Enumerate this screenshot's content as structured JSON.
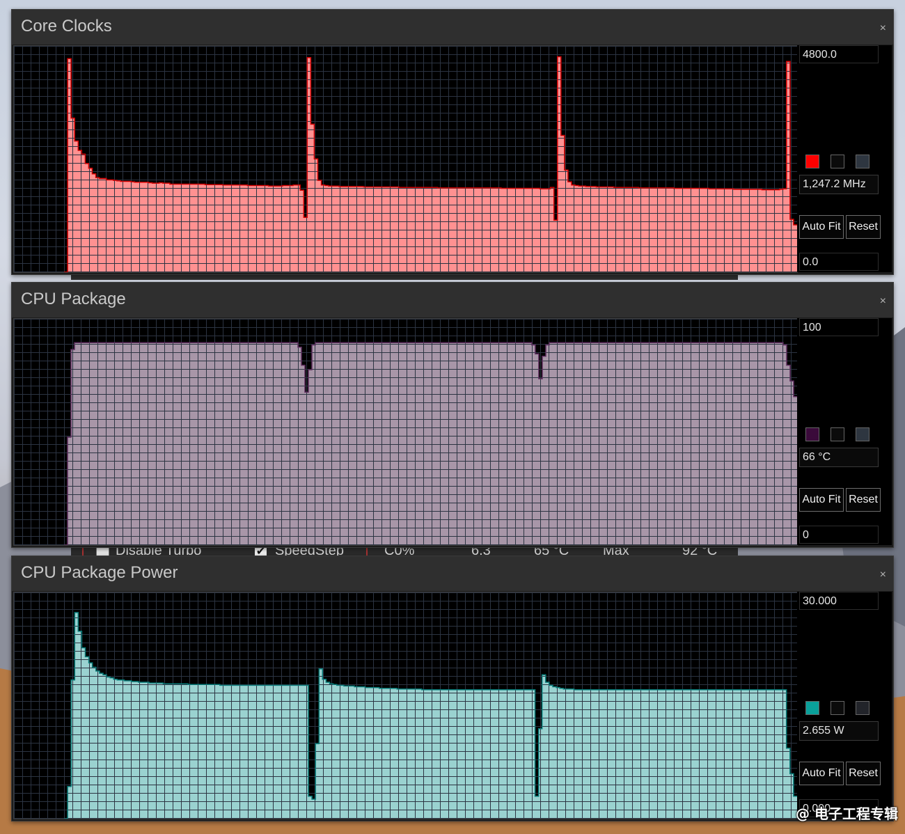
{
  "panels": [
    {
      "id": "core-clocks",
      "title": "Core Clocks",
      "close": "×",
      "max_label": "4800.0",
      "min_label": "0.0",
      "current": "1,247.2 MHz",
      "swatches": [
        "#ff0000",
        "#0b0b0b",
        "#2e3640"
      ],
      "buttons": [
        "Auto Fit",
        "Reset"
      ],
      "fill_color": "#ff9191",
      "edge_color": "#d10000",
      "ymax": 4800,
      "series": [
        0,
        4560,
        3290,
        2800,
        2600,
        2520,
        2320,
        2220,
        2100,
        2020,
        2000,
        2000,
        1970,
        1970,
        1960,
        1950,
        1940,
        1940,
        1940,
        1930,
        1920,
        1920,
        1920,
        1920,
        1910,
        1900,
        1900,
        1910,
        1900,
        1900,
        1880,
        1880,
        1880,
        1880,
        1880,
        1880,
        1880,
        1880,
        1880,
        1880,
        1870,
        1870,
        1870,
        1870,
        1870,
        1860,
        1860,
        1860,
        1860,
        1860,
        1860,
        1860,
        1850,
        1850,
        1850,
        1850,
        1850,
        1850,
        1840,
        1840,
        1840,
        1840,
        1850,
        1850,
        1850,
        1860,
        1860,
        1750,
        1170,
        4580,
        3160,
        2420,
        1960,
        1860,
        1850,
        1840,
        1840,
        1840,
        1830,
        1830,
        1830,
        1830,
        1830,
        1830,
        1830,
        1820,
        1820,
        1820,
        1820,
        1820,
        1820,
        1820,
        1820,
        1820,
        1820,
        1810,
        1810,
        1810,
        1810,
        1810,
        1810,
        1810,
        1810,
        1810,
        1810,
        1810,
        1800,
        1800,
        1800,
        1800,
        1800,
        1800,
        1800,
        1800,
        1800,
        1800,
        1800,
        1800,
        1800,
        1800,
        1800,
        1800,
        1800,
        1800,
        1790,
        1790,
        1790,
        1790,
        1790,
        1790,
        1790,
        1790,
        1790,
        1790,
        1790,
        1780,
        1780,
        1780,
        1810,
        1110,
        4600,
        2920,
        2180,
        1930,
        1860,
        1850,
        1840,
        1840,
        1830,
        1830,
        1830,
        1820,
        1820,
        1820,
        1820,
        1820,
        1810,
        1810,
        1810,
        1810,
        1810,
        1810,
        1810,
        1800,
        1800,
        1800,
        1800,
        1800,
        1800,
        1800,
        1800,
        1800,
        1800,
        1790,
        1790,
        1790,
        1790,
        1790,
        1790,
        1790,
        1790,
        1790,
        1790,
        1780,
        1780,
        1780,
        1780,
        1780,
        1780,
        1780,
        1770,
        1770,
        1770,
        1770,
        1770,
        1770,
        1770,
        1770,
        1760,
        1760,
        1760,
        1760,
        1760,
        1770,
        1780,
        4500,
        1130,
        1010
      ]
    },
    {
      "id": "cpu-package",
      "title": "CPU Package",
      "close": "×",
      "max_label": "100",
      "min_label": "0",
      "current": "66 °C",
      "swatches": [
        "#3a0a3a",
        "#0b0b0b",
        "#2e3640"
      ],
      "buttons": [
        "Auto Fit",
        "Reset"
      ],
      "fill_color": "#a896a8",
      "edge_color": "#5e2e5e",
      "ymax": 100,
      "series": [
        0,
        48,
        87,
        90,
        90,
        90,
        90,
        90,
        90,
        90,
        90,
        90,
        90,
        90,
        90,
        90,
        90,
        90,
        90,
        90,
        90,
        90,
        90,
        90,
        90,
        90,
        90,
        90,
        90,
        90,
        90,
        90,
        90,
        90,
        90,
        90,
        90,
        90,
        90,
        90,
        90,
        90,
        90,
        90,
        90,
        90,
        90,
        90,
        90,
        90,
        90,
        90,
        90,
        90,
        90,
        90,
        90,
        90,
        90,
        90,
        90,
        90,
        90,
        90,
        90,
        90,
        90,
        88,
        80,
        68,
        78,
        89,
        90,
        90,
        90,
        90,
        90,
        90,
        90,
        90,
        90,
        90,
        90,
        90,
        90,
        90,
        90,
        90,
        90,
        90,
        90,
        90,
        90,
        90,
        90,
        90,
        90,
        90,
        90,
        90,
        90,
        90,
        90,
        90,
        90,
        90,
        90,
        90,
        90,
        90,
        90,
        90,
        90,
        90,
        90,
        90,
        90,
        90,
        90,
        90,
        90,
        90,
        90,
        90,
        90,
        90,
        90,
        90,
        90,
        90,
        90,
        90,
        90,
        90,
        89,
        85,
        74,
        84,
        89,
        90,
        90,
        90,
        90,
        90,
        90,
        90,
        90,
        90,
        90,
        90,
        90,
        90,
        90,
        90,
        90,
        90,
        90,
        90,
        90,
        90,
        90,
        90,
        90,
        90,
        90,
        90,
        90,
        90,
        90,
        90,
        90,
        90,
        90,
        90,
        90,
        90,
        90,
        90,
        90,
        90,
        90,
        90,
        90,
        90,
        90,
        90,
        90,
        90,
        90,
        90,
        90,
        90,
        90,
        90,
        90,
        90,
        90,
        90,
        90,
        90,
        90,
        90,
        90,
        90,
        90,
        90,
        89,
        80,
        73,
        66
      ]
    },
    {
      "id": "cpu-package-power",
      "title": "CPU Package Power",
      "close": "×",
      "max_label": "30.000",
      "min_label": "0.000",
      "current": "2.655 W",
      "swatches": [
        "#0aa09a",
        "#0b0b0b",
        "#22242a"
      ],
      "buttons": [
        "Auto Fit",
        "Reset"
      ],
      "fill_color": "#9ad2d0",
      "edge_color": "#087a77",
      "ymax": 30,
      "series": [
        0,
        4.3,
        18.5,
        27.5,
        25.0,
        22.8,
        21.6,
        20.8,
        20.2,
        19.7,
        19.4,
        19.2,
        18.9,
        18.8,
        18.6,
        18.5,
        18.5,
        18.4,
        18.4,
        18.3,
        18.3,
        18.2,
        18.2,
        18.2,
        18.1,
        18.1,
        18.1,
        18.1,
        18.0,
        18.0,
        18.0,
        18.0,
        18.0,
        18.0,
        18.0,
        17.9,
        17.9,
        17.9,
        17.9,
        17.9,
        17.9,
        17.9,
        17.9,
        17.9,
        17.8,
        17.8,
        17.8,
        17.8,
        17.8,
        17.8,
        17.8,
        17.8,
        17.8,
        17.8,
        17.8,
        17.8,
        17.8,
        17.8,
        17.8,
        17.8,
        17.8,
        17.8,
        17.8,
        17.8,
        17.8,
        17.8,
        17.8,
        17.8,
        17.8,
        3.0,
        2.6,
        10.0,
        20.0,
        18.6,
        18.2,
        18.0,
        17.9,
        17.8,
        17.8,
        17.7,
        17.7,
        17.7,
        17.6,
        17.6,
        17.6,
        17.5,
        17.5,
        17.5,
        17.5,
        17.4,
        17.4,
        17.4,
        17.4,
        17.4,
        17.3,
        17.3,
        17.3,
        17.3,
        17.3,
        17.3,
        17.3,
        17.2,
        17.2,
        17.2,
        17.2,
        17.2,
        17.2,
        17.2,
        17.2,
        17.2,
        17.2,
        17.2,
        17.2,
        17.2,
        17.2,
        17.2,
        17.2,
        17.2,
        17.2,
        17.2,
        17.2,
        17.2,
        17.2,
        17.2,
        17.2,
        17.2,
        17.2,
        17.2,
        17.2,
        17.2,
        17.2,
        17.2,
        17.2,
        3.0,
        12.0,
        19.2,
        18.2,
        17.8,
        17.6,
        17.5,
        17.4,
        17.3,
        17.3,
        17.3,
        17.2,
        17.2,
        17.2,
        17.2,
        17.2,
        17.2,
        17.2,
        17.2,
        17.2,
        17.2,
        17.2,
        17.2,
        17.2,
        17.2,
        17.2,
        17.2,
        17.2,
        17.2,
        17.2,
        17.2,
        17.2,
        17.2,
        17.2,
        17.2,
        17.2,
        17.2,
        17.2,
        17.2,
        17.2,
        17.2,
        17.2,
        17.2,
        17.2,
        17.2,
        17.2,
        17.2,
        17.2,
        17.2,
        17.2,
        17.2,
        17.2,
        17.2,
        17.2,
        17.2,
        17.2,
        17.2,
        17.2,
        17.2,
        17.2,
        17.2,
        17.2,
        17.2,
        17.2,
        17.2,
        17.2,
        17.2,
        17.2,
        17.2,
        17.2,
        17.2,
        9.4,
        6.0,
        3.0
      ]
    }
  ],
  "background_strip": {
    "items": [
      "Disable Turbo",
      "SpeedStep",
      "C0%",
      "6.3",
      "65 °C",
      "Max",
      "92 °C"
    ]
  },
  "watermark": "@ 电子工程专辑"
}
